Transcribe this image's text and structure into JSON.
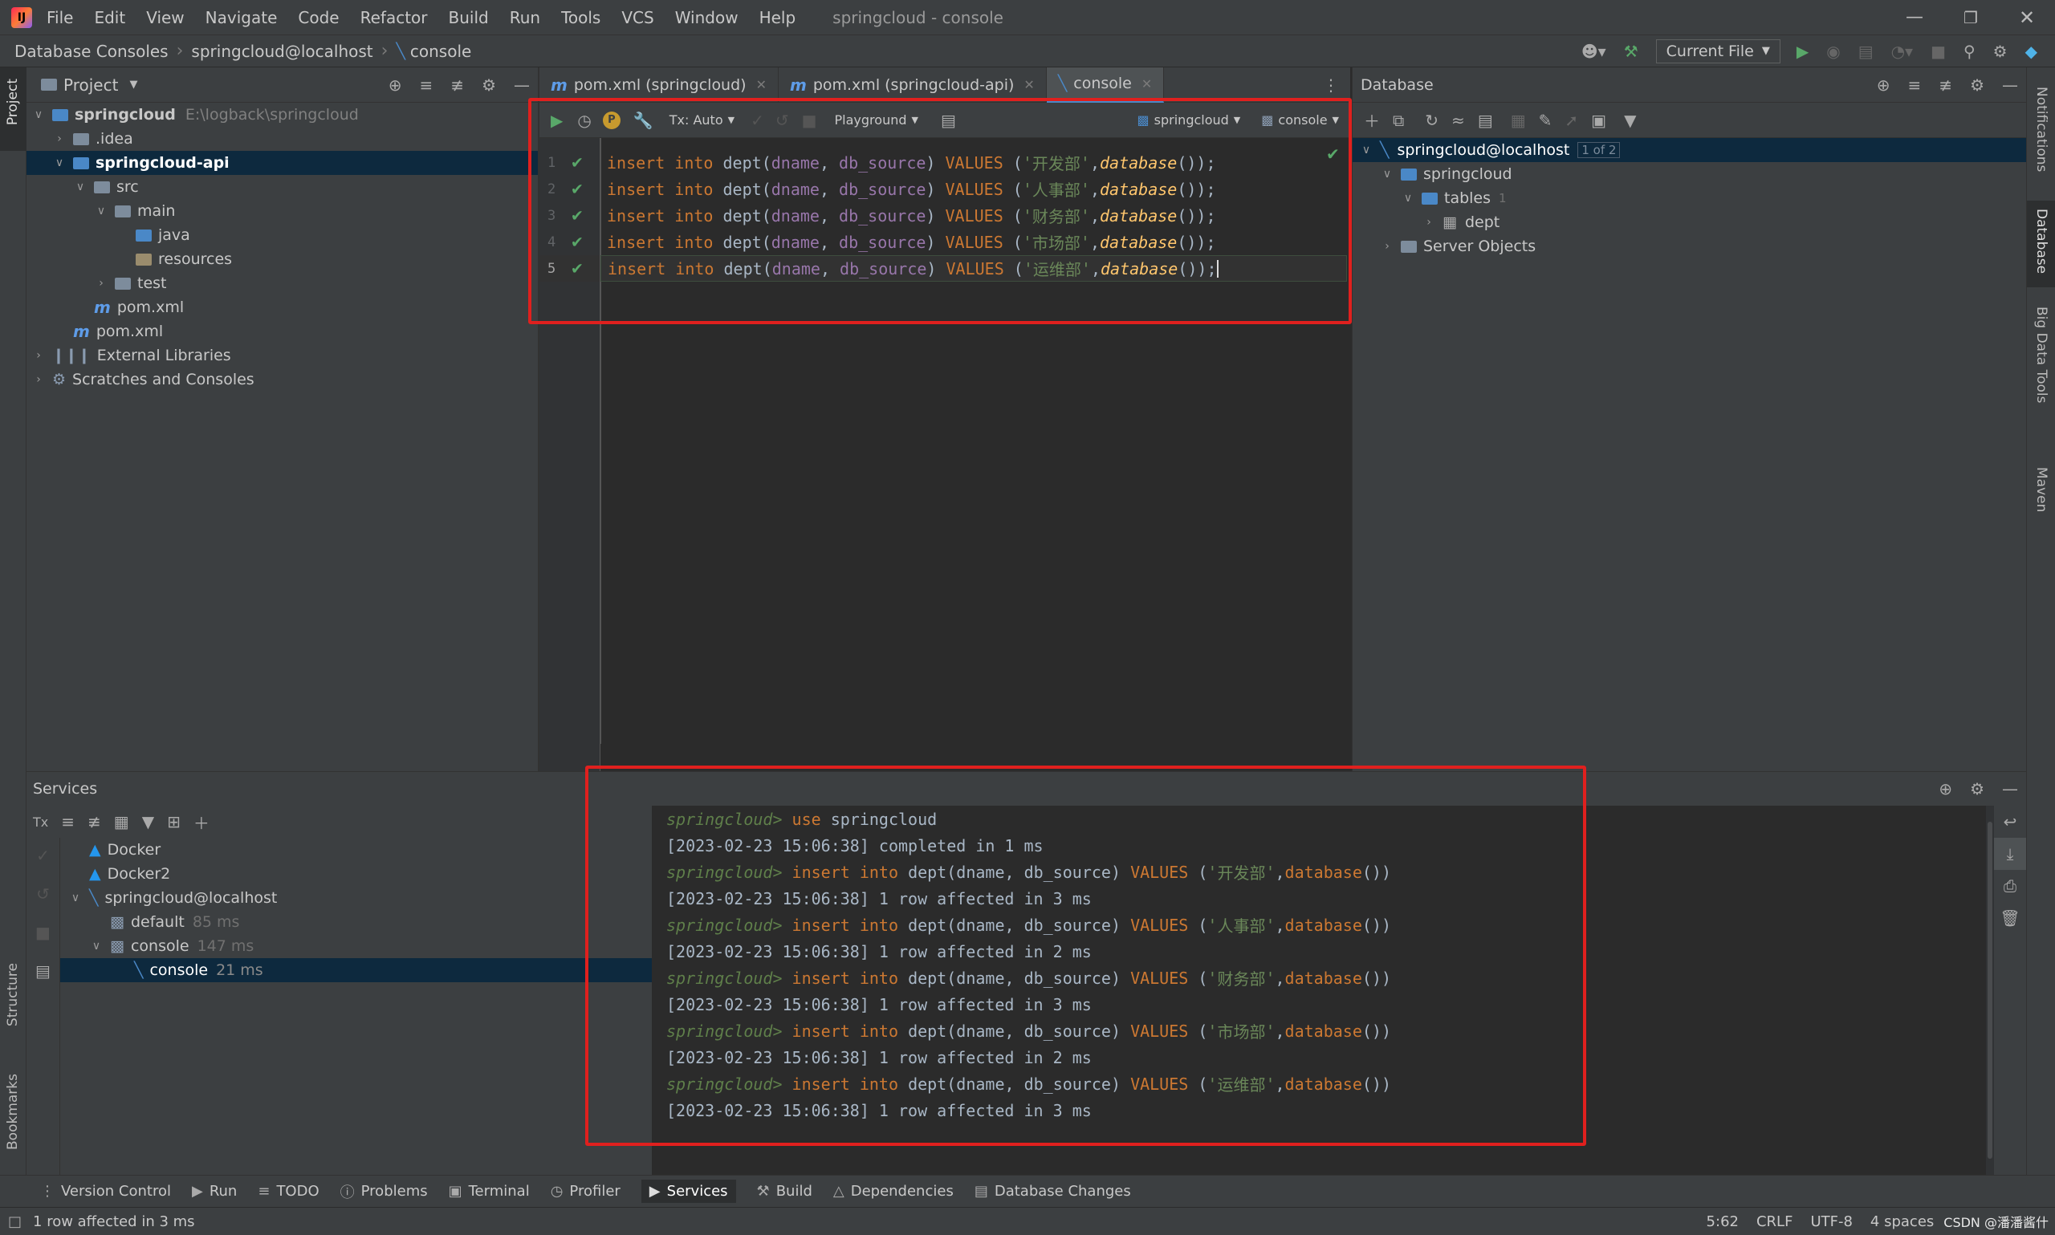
{
  "menubar": {
    "items": [
      "File",
      "Edit",
      "View",
      "Navigate",
      "Code",
      "Refactor",
      "Build",
      "Run",
      "Tools",
      "VCS",
      "Window",
      "Help"
    ],
    "title": "springcloud - console"
  },
  "navbar": {
    "crumbs": [
      "Database Consoles",
      "springcloud@localhost",
      "console"
    ],
    "run_config": "Current File"
  },
  "project": {
    "title": "Project",
    "tree": [
      {
        "label": "springcloud",
        "extra": "E:\\logback\\springcloud"
      },
      {
        "label": ".idea"
      },
      {
        "label": "springcloud-api"
      },
      {
        "label": "src"
      },
      {
        "label": "main"
      },
      {
        "label": "java"
      },
      {
        "label": "resources"
      },
      {
        "label": "test"
      },
      {
        "label": "pom.xml"
      },
      {
        "label": "pom.xml"
      },
      {
        "label": "External Libraries"
      },
      {
        "label": "Scratches and Consoles"
      }
    ]
  },
  "editor": {
    "tabs": [
      "pom.xml (springcloud)",
      "pom.xml (springcloud-api)",
      "console"
    ],
    "toolbar": {
      "tx": "Tx: Auto",
      "playground": "Playground",
      "schema": "springcloud",
      "session": "console"
    },
    "lines": [
      {
        "n": "1",
        "dept": "开发部"
      },
      {
        "n": "2",
        "dept": "人事部"
      },
      {
        "n": "3",
        "dept": "财务部"
      },
      {
        "n": "4",
        "dept": "市场部"
      },
      {
        "n": "5",
        "dept": "运维部"
      }
    ],
    "tokens": {
      "insert": "insert",
      "into": "into",
      "table": "dept",
      "col1": "dname",
      "col2": "db_source",
      "values": "VALUES",
      "func": "database",
      "open": "(",
      "comma": ", ",
      "close": ")",
      "q": "'",
      "tail": "());",
      "str_sep": "',"
    }
  },
  "database": {
    "title": "Database",
    "tree": [
      {
        "label": "springcloud@localhost",
        "badge": "1 of 2"
      },
      {
        "label": "springcloud"
      },
      {
        "label": "tables",
        "count": "1"
      },
      {
        "label": "dept"
      },
      {
        "label": "Server Objects"
      }
    ]
  },
  "services": {
    "title": "Services",
    "tree": [
      {
        "label": "Docker"
      },
      {
        "label": "Docker2"
      },
      {
        "label": "springcloud@localhost"
      },
      {
        "label": "default",
        "time": "85 ms"
      },
      {
        "label": "console",
        "time": "147 ms"
      },
      {
        "label": "console",
        "time": "21 ms"
      }
    ]
  },
  "console": {
    "prompt": "springcloud>",
    "use_cmd": "use springcloud",
    "lines": [
      {
        "type": "cmd",
        "text": "use springcloud"
      },
      {
        "type": "out",
        "text": "[2023-02-23 15:06:38] completed in 1 ms"
      },
      {
        "type": "ins",
        "dept": "开发部"
      },
      {
        "type": "out",
        "text": "[2023-02-23 15:06:38] 1 row affected in 3 ms"
      },
      {
        "type": "ins",
        "dept": "人事部"
      },
      {
        "type": "out",
        "text": "[2023-02-23 15:06:38] 1 row affected in 2 ms"
      },
      {
        "type": "ins",
        "dept": "财务部"
      },
      {
        "type": "out",
        "text": "[2023-02-23 15:06:38] 1 row affected in 3 ms"
      },
      {
        "type": "ins",
        "dept": "市场部"
      },
      {
        "type": "out",
        "text": "[2023-02-23 15:06:38] 1 row affected in 2 ms"
      },
      {
        "type": "ins",
        "dept": "运维部"
      },
      {
        "type": "out",
        "text": "[2023-02-23 15:06:38] 1 row affected in 3 ms"
      }
    ]
  },
  "bottom_tabs": [
    "Version Control",
    "Run",
    "TODO",
    "Problems",
    "Terminal",
    "Profiler",
    "Services",
    "Build",
    "Dependencies",
    "Database Changes"
  ],
  "left_strip": [
    "Project",
    "Structure",
    "Bookmarks"
  ],
  "right_strip": [
    "Notifications",
    "Database",
    "Big Data Tools",
    "Maven"
  ],
  "status": {
    "message": "1 row affected in 3 ms",
    "position": "5:62",
    "line_sep": "CRLF",
    "encoding": "UTF-8",
    "indent": "4 spaces",
    "watermark": "CSDN @潘潘酱什"
  },
  "colors": {
    "highlight": "#e0201e",
    "accent": "#4a88c7",
    "ok": "#59a869"
  }
}
